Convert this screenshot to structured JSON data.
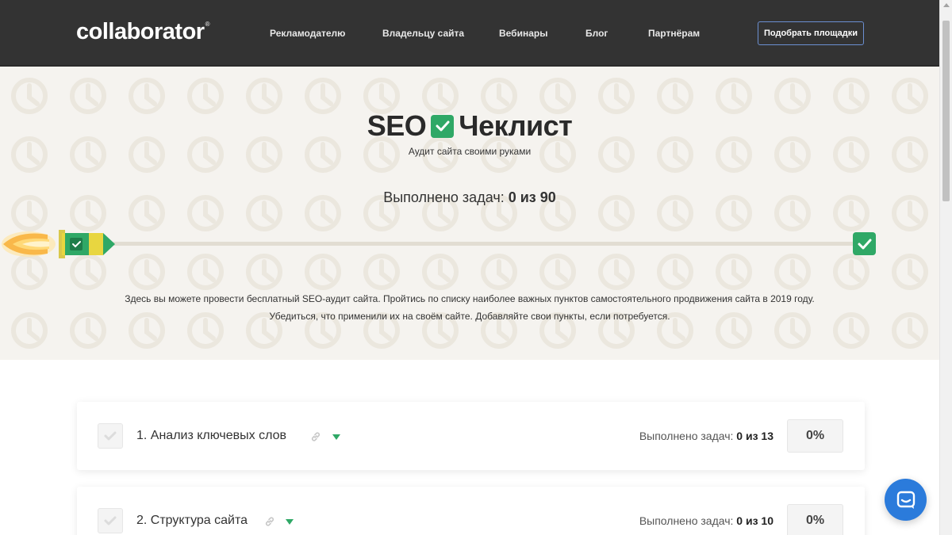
{
  "header": {
    "logo": "collaborator",
    "logo_mark": "®",
    "nav": [
      {
        "label": "Рекламодателю"
      },
      {
        "label": "Владельцу сайта"
      },
      {
        "label": "Вебинары"
      },
      {
        "label": "Блог"
      },
      {
        "label": "Партнёрам"
      }
    ],
    "cta_label": "Подобрать площадки"
  },
  "hero": {
    "title_left": "SEO",
    "title_right": "Чеклист",
    "subtitle": "Аудит сайта своими руками",
    "progress_prefix": "Выполнено задач:",
    "progress_value": "0 из 90",
    "progress_fraction": 0,
    "description_line1": "Здесь вы можете провести бесплатный SEO-аудит сайта. Пройтись по списку наиболее важных пунктов самостоятельного продвижения сайта в 2019 году.",
    "description_line2": "Убедиться, что применили их на своём сайте. Добавляйте свои пункты, если потребуется."
  },
  "sections": [
    {
      "title": "1. Анализ ключевых слов",
      "progress_prefix": "Выполнено задач:",
      "progress_value": "0 из 13",
      "percent": "0%"
    },
    {
      "title": "2. Структура сайта",
      "progress_prefix": "Выполнено задач:",
      "progress_value": "0 из 10",
      "percent": "0%"
    }
  ],
  "colors": {
    "header_bg": "#333333",
    "accent_green": "#2fa866",
    "chat_blue": "#2b7bdb",
    "hero_bg": "#f5f3ef"
  },
  "icons": {
    "chat": "chat-bubble-icon",
    "link": "link-icon",
    "caret": "caret-down-icon",
    "check": "check-icon"
  }
}
